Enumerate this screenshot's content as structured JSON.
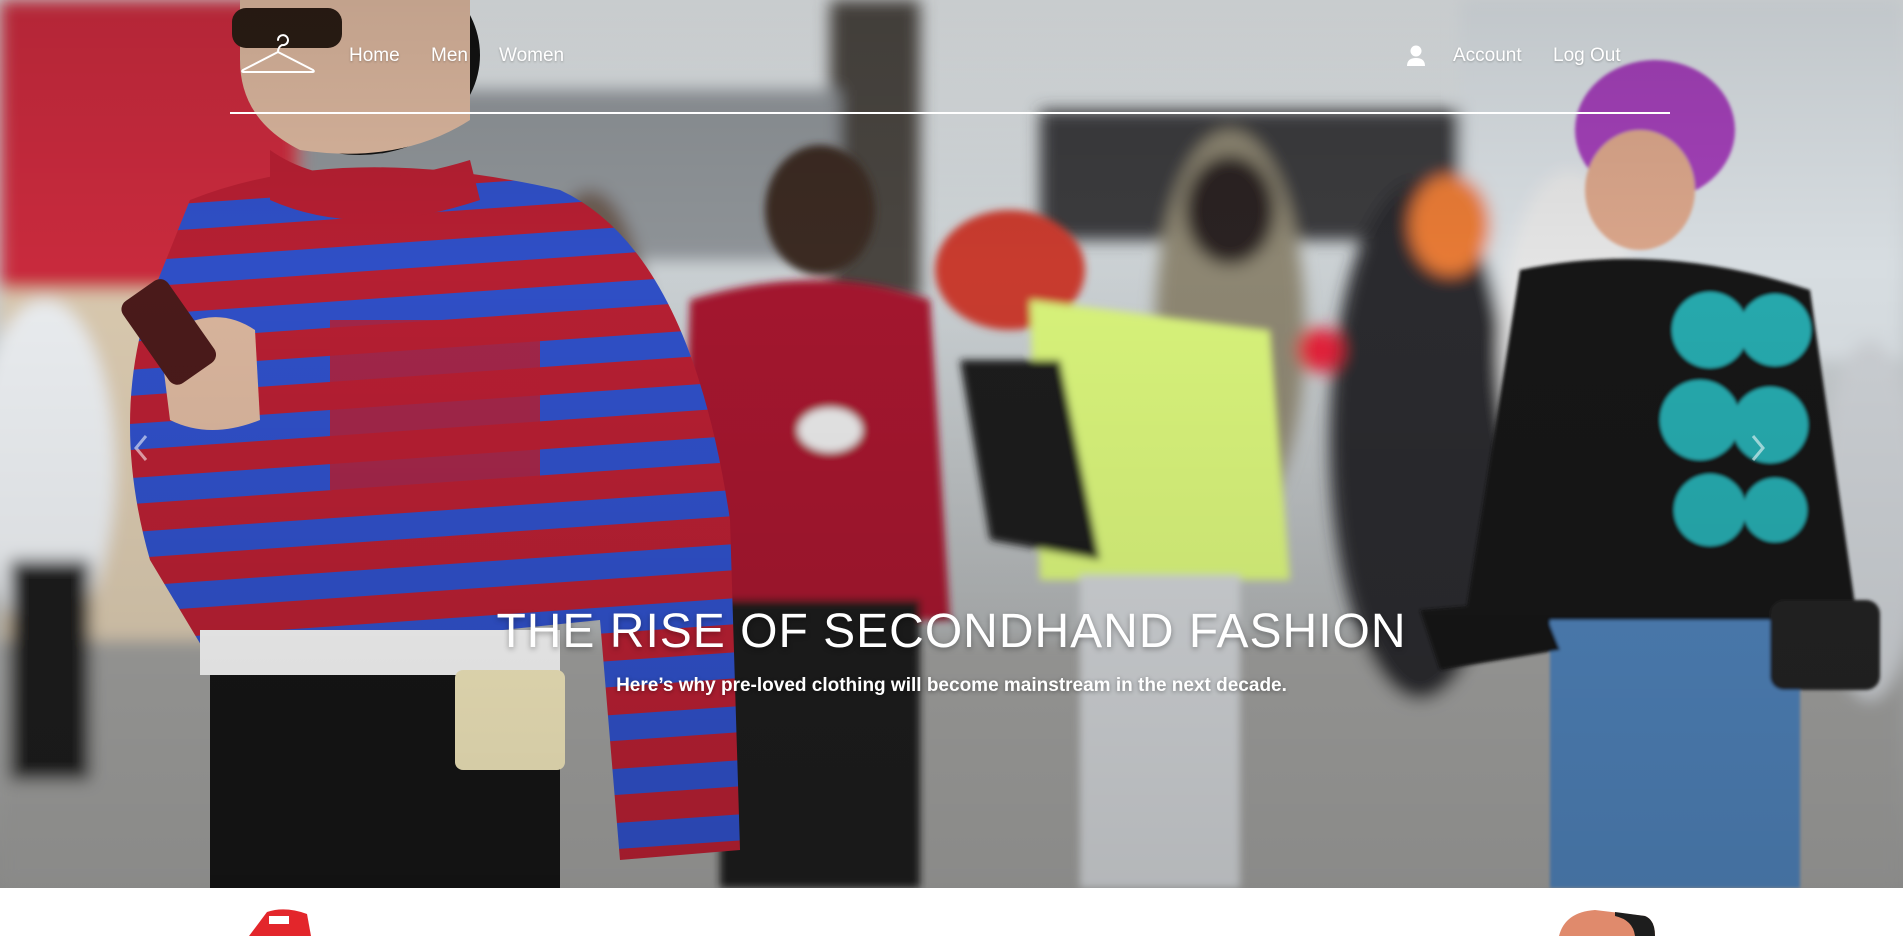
{
  "nav": {
    "logo_icon": "hanger-icon",
    "links": {
      "home": "Home",
      "men": "Men",
      "women": "Women"
    },
    "account_icon": "user-icon",
    "account": "Account",
    "logout": "Log Out"
  },
  "hero": {
    "title": "THE RISE OF SECONDHAND FASHION",
    "subtitle": "Here’s why pre-loved clothing will become mainstream in the next decade.",
    "prev_icon": "chevron-left-icon",
    "next_icon": "chevron-right-icon"
  },
  "colors": {
    "nav_text": "#ffffff",
    "sweater_red": "#b51f32",
    "sweater_blue": "#2f4fc6",
    "jacket_red": "#a3182e",
    "neon_green": "#d7f27a",
    "teal_print": "#25a9ad",
    "purple_hair": "#a23fb7"
  }
}
